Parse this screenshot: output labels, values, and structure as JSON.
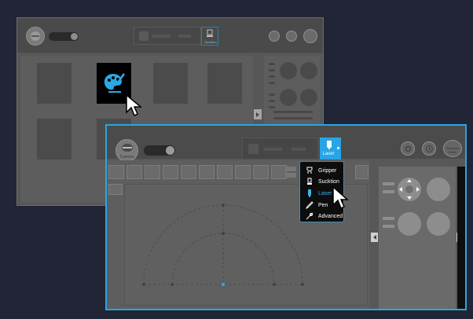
{
  "back_window": {
    "mode_label": "Sucktion",
    "top_left_label": ""
  },
  "front_window": {
    "camera_label": "Camera",
    "mode_label": "Laser",
    "right_btn_label": "Firmware Mode",
    "tool_menu": {
      "items": [
        {
          "label": "Gripper",
          "icon": "gripper-icon",
          "active": false
        },
        {
          "label": "Sucktion",
          "icon": "suction-cup-icon",
          "active": false
        },
        {
          "label": "Laser",
          "icon": "laser-icon",
          "active": true
        },
        {
          "label": "Pen",
          "icon": "pen-icon",
          "active": false
        },
        {
          "label": "Advanced",
          "icon": "advanced-icon",
          "active": false
        }
      ]
    }
  },
  "colors": {
    "accent": "#27a5e5",
    "background": "#212536",
    "active_text": "#3eb0ee"
  }
}
